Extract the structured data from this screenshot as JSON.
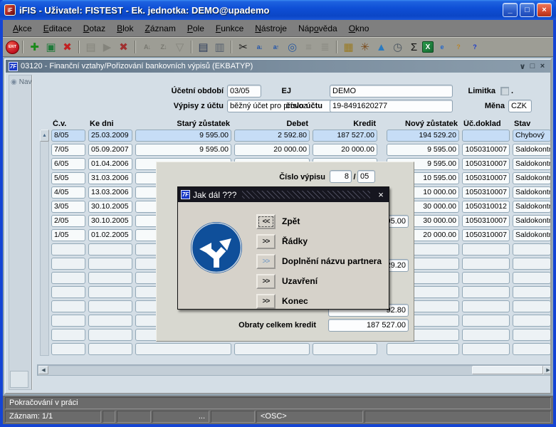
{
  "window": {
    "title": "iFIS - Uživatel: FISTEST - Ek. jednotka: DEMO@upademo",
    "app_icon": "iFIS-logo",
    "controls": {
      "minimize": "_",
      "maximize": "□",
      "close": "×"
    }
  },
  "menubar": {
    "items": [
      {
        "label": "Akce",
        "u": 0
      },
      {
        "label": "Editace",
        "u": 0
      },
      {
        "label": "Dotaz",
        "u": 0
      },
      {
        "label": "Blok",
        "u": 0
      },
      {
        "label": "Záznam",
        "u": 0
      },
      {
        "label": "Pole",
        "u": 0
      },
      {
        "label": "Funkce",
        "u": 0
      },
      {
        "label": "Nástroje",
        "u": 0
      },
      {
        "label": "Nápověda",
        "u": 3
      },
      {
        "label": "Okno",
        "u": 0
      }
    ]
  },
  "toolbar": {
    "items": [
      {
        "k": "exit",
        "name": "exit-icon",
        "text": "EXIT"
      },
      {
        "k": "sep"
      },
      {
        "k": "g",
        "name": "insert-record-icon",
        "glyph": "✚",
        "color": "#1a8a1a"
      },
      {
        "k": "g",
        "name": "duplicate-record-icon",
        "glyph": "▣",
        "color": "#1f7a3a"
      },
      {
        "k": "g",
        "name": "delete-record-icon",
        "glyph": "✖",
        "color": "#c22222"
      },
      {
        "k": "sep"
      },
      {
        "k": "g",
        "name": "enter-query-icon",
        "glyph": "▤",
        "color": "#84847c"
      },
      {
        "k": "g",
        "name": "execute-query-icon",
        "glyph": "▶",
        "color": "#84847c"
      },
      {
        "k": "g",
        "name": "cancel-query-icon",
        "glyph": "✖",
        "color": "#a03030"
      },
      {
        "k": "sep"
      },
      {
        "k": "t",
        "name": "sort-ascending-icon",
        "glyph": "A↓",
        "color": "#787870"
      },
      {
        "k": "t",
        "name": "sort-descending-icon",
        "glyph": "Z↓",
        "color": "#787870"
      },
      {
        "k": "g",
        "name": "filter-icon",
        "glyph": "▽",
        "color": "#84847c"
      },
      {
        "k": "sep"
      },
      {
        "k": "g",
        "name": "print-icon",
        "glyph": "▤",
        "color": "#2a3a5a"
      },
      {
        "k": "g",
        "name": "print-setup-icon",
        "glyph": "▥",
        "color": "#55606e"
      },
      {
        "k": "sep"
      },
      {
        "k": "g",
        "name": "cut-icon",
        "glyph": "✂",
        "color": "#1a1a1a"
      },
      {
        "k": "t",
        "name": "copy-field-icon",
        "glyph": "a↓",
        "color": "#2255aa"
      },
      {
        "k": "t",
        "name": "paste-field-icon",
        "glyph": "a↑",
        "color": "#2255aa"
      },
      {
        "k": "g",
        "name": "find-icon",
        "glyph": "◎",
        "color": "#2a5aa0"
      },
      {
        "k": "g",
        "name": "outline-list-icon",
        "glyph": "≡",
        "color": "#8a8a82"
      },
      {
        "k": "g",
        "name": "outline-tree-icon",
        "glyph": "≣",
        "color": "#8a8a82"
      },
      {
        "k": "sep"
      },
      {
        "k": "g",
        "name": "editor-card-icon",
        "glyph": "▦",
        "color": "#9a7a22"
      },
      {
        "k": "g",
        "name": "navigator-helm-icon",
        "glyph": "✳",
        "color": "#7a4a1a"
      },
      {
        "k": "g",
        "name": "scenery-window-icon",
        "glyph": "▲",
        "color": "#2a7ac0"
      },
      {
        "k": "g",
        "name": "calendar-clock-icon",
        "glyph": "◷",
        "color": "#4a5560"
      },
      {
        "k": "g",
        "name": "sum-sigma-icon",
        "glyph": "Σ",
        "color": "#111111"
      },
      {
        "k": "excel",
        "name": "excel-export-icon",
        "text": "X"
      },
      {
        "k": "t",
        "name": "web-browser-icon",
        "glyph": "e",
        "color": "#2266cc"
      },
      {
        "k": "t",
        "name": "about-help-icon",
        "glyph": "?",
        "color": "#b8862a"
      },
      {
        "k": "t",
        "name": "help-icon",
        "glyph": "?",
        "color": "#1a3acc"
      }
    ]
  },
  "inner_window": {
    "title": "03120 - Finanční vztahy/Pořizování bankovních výpisů (EKBATYP)",
    "controls": {
      "minimize": "∨",
      "restore": "□",
      "close": "×"
    }
  },
  "nav": {
    "label": "Nav",
    "radio_icon": "◉"
  },
  "form": {
    "ucetni_obdobi_label": "Účetní období",
    "ucetni_obdobi_value": "03/05",
    "ej_label": "EJ",
    "ej_value": "DEMO",
    "limitka_label": "Limitka",
    "limitka_suffix": ".",
    "vypisy_label": "Výpisy z účtu",
    "vypisy_value": "běžný účet pro provoz",
    "cislo_uctu_label": "číslo účtu",
    "cislo_uctu_value": "19-8491620277",
    "mena_label": "Měna",
    "mena_value": "CZK"
  },
  "table": {
    "columns": [
      "Č.v.",
      "Ke dni",
      "Starý zůstatek",
      "Debet",
      "Kredit",
      "Nový zůstatek",
      "Úč.doklad",
      "Stav"
    ],
    "rows": [
      [
        "8/05",
        "25.03.2009",
        "9 595.00",
        "2 592.80",
        "187 527.00",
        "194 529.20",
        "",
        "Chybový"
      ],
      [
        "7/05",
        "05.09.2007",
        "9 595.00",
        "20 000.00",
        "20 000.00",
        "9 595.00",
        "1050310007",
        "Saldokontně"
      ],
      [
        "6/05",
        "01.04.2006",
        "",
        "",
        "",
        "9 595.00",
        "1050310007",
        "Saldokontně"
      ],
      [
        "5/05",
        "31.03.2006",
        "",
        "",
        "",
        "10 595.00",
        "1050310007",
        "Saldokontně"
      ],
      [
        "4/05",
        "13.03.2006",
        "",
        "",
        "",
        "10 000.00",
        "1050310007",
        "Saldokontně"
      ],
      [
        "3/05",
        "30.10.2005",
        "",
        "",
        "",
        "30 000.00",
        "1050310012",
        "Saldokontně"
      ],
      [
        "2/05",
        "30.10.2005",
        "",
        "",
        "",
        "30 000.00",
        "1050310007",
        "Saldokontně"
      ],
      [
        "1/05",
        "01.02.2005",
        "",
        "",
        "",
        "20 000.00",
        "1050310007",
        "Saldokontně"
      ]
    ],
    "selected_row": 0,
    "empty_row_count": 8,
    "row_selector_icon": "▲"
  },
  "panel": {
    "cislo_vypisu_label": "Číslo výpisu",
    "cislo_vypisu_value": "8",
    "cislo_vypisu_sep": "/",
    "cislo_vypisu_suffix": "05",
    "partial_field_1": "95.00",
    "partial_field_2": "29.20",
    "partial_field_3": "92.80",
    "obraty_kredit_label": "Obraty celkem kredit",
    "obraty_kredit_value": "187 527.00"
  },
  "dialog": {
    "title": "Jak dál ???",
    "close": "×",
    "sign_icon": "fork-road-sign",
    "buttons": [
      {
        "glyph": "<<",
        "label": "Zpět",
        "focused": true
      },
      {
        "glyph": ">>",
        "label": "Řádky"
      },
      {
        "glyph": ">>",
        "label": "Doplnění názvu partnera",
        "disabled": true
      },
      {
        "glyph": ">>",
        "label": "Uzavření"
      },
      {
        "glyph": ">>",
        "label": "Konec"
      }
    ]
  },
  "scrollbar": {
    "left_arrow": "◀",
    "right_arrow": "▶"
  },
  "statusbar": {
    "message": "Pokračování v práci",
    "cells": [
      "Záznam: 1/1",
      "",
      "",
      "...",
      "",
      "<OSC>",
      ""
    ]
  }
}
